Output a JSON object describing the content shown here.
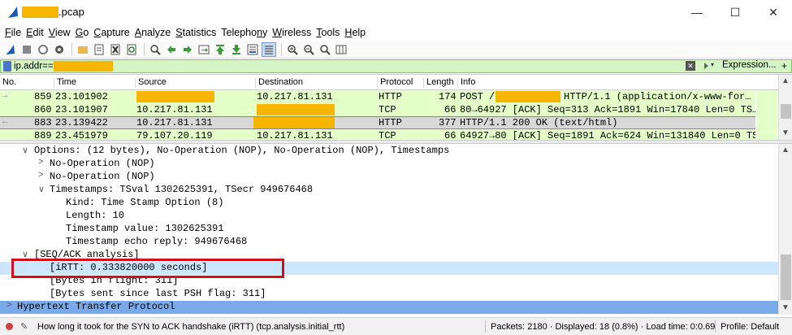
{
  "window": {
    "title_suffix": ".pcap",
    "minimize": "—",
    "maximize": "☐",
    "close": "✕"
  },
  "menu": [
    "File",
    "Edit",
    "View",
    "Go",
    "Capture",
    "Analyze",
    "Statistics",
    "Telephony",
    "Wireless",
    "Tools",
    "Help"
  ],
  "menu_underline": [
    "F",
    "E",
    "V",
    "G",
    "C",
    "A",
    "S",
    "n",
    "W",
    "T",
    "H"
  ],
  "filter": {
    "prefix": "ip.addr==",
    "expression_label": "Expression...",
    "plus": "+"
  },
  "packet_list": {
    "headers": [
      "No.",
      "Time",
      "Source",
      "Destination",
      "Protocol",
      "Length",
      "Info"
    ],
    "rows": [
      {
        "no": "859",
        "time": "23.101902",
        "source": "",
        "destination": "10.217.81.131",
        "protocol": "HTTP",
        "length": "174",
        "info": "POST /",
        "info2": "HTTP/1.1  (application/x-www-for…"
      },
      {
        "no": "860",
        "time": "23.101907",
        "source": "10.217.81.131",
        "destination": "",
        "protocol": "TCP",
        "length": "66",
        "info": "80→64927 [ACK] Seq=313 Ack=1891 Win=17840 Len=0 TS…",
        "info2": ""
      },
      {
        "no": "883",
        "time": "23.139422",
        "source": "10.217.81.131",
        "destination": "",
        "protocol": "HTTP",
        "length": "377",
        "info": "HTTP/1.1 200 OK  (text/html)",
        "info2": ""
      },
      {
        "no": "889",
        "time": "23.451979",
        "source": "79.107.20.119",
        "destination": "10.217.81.131",
        "protocol": "TCP",
        "length": "66",
        "info": "64927→80 [ACK] Seq=1891 Ack=624 Win=131840 Len=0 TS…",
        "info2": ""
      }
    ]
  },
  "details": [
    {
      "caret": "∨",
      "text": "Options: (12 bytes), No-Operation (NOP), No-Operation (NOP), Timestamps"
    },
    {
      "caret": ">",
      "text": "No-Operation (NOP)"
    },
    {
      "caret": ">",
      "text": "No-Operation (NOP)"
    },
    {
      "caret": "∨",
      "text": "Timestamps: TSval 1302625391, TSecr 949676468"
    },
    {
      "caret": "",
      "text": "Kind: Time Stamp Option (8)"
    },
    {
      "caret": "",
      "text": "Length: 10"
    },
    {
      "caret": "",
      "text": "Timestamp value: 1302625391"
    },
    {
      "caret": "",
      "text": "Timestamp echo reply: 949676468"
    },
    {
      "caret": "∨",
      "text": "[SEQ/ACK analysis]"
    },
    {
      "caret": "",
      "text": "[iRTT: 0.333820000 seconds]"
    },
    {
      "caret": "",
      "text": "[Bytes in flight: 311]"
    },
    {
      "caret": "",
      "text": "[Bytes sent since last PSH flag: 311]"
    },
    {
      "caret": ">",
      "text": "Hypertext Transfer Protocol"
    }
  ],
  "status": {
    "field_info": "How long it took for the SYN to ACK handshake (iRTT) (tcp.analysis.initial_rtt)",
    "packets": "Packets: 2180 · Displayed: 18 (0.8%) · Load time: 0:0.69",
    "profile": "Profile: Default"
  },
  "colors": {
    "redaction": "#f7b500",
    "filter_valid": "#d5f5c4",
    "http_row": "#e4ffc7",
    "selected_detail": "#cce6ff",
    "hover_detail": "#7aaae9",
    "callout": "#d0101a"
  }
}
